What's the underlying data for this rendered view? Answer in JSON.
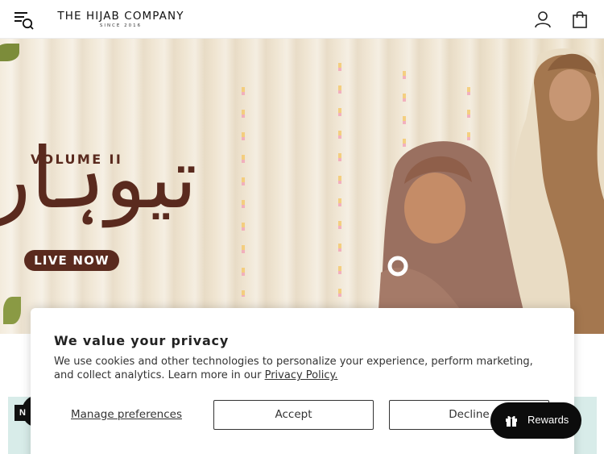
{
  "header": {
    "brand_name": "THE HIJAB COMPANY",
    "brand_tagline": "SINCE 2016",
    "icons": [
      "menu-search-icon",
      "account-icon",
      "shopping-bag-icon"
    ]
  },
  "hero": {
    "volume_label": "VOLUME II",
    "title_urdu": "تیوہار",
    "cta_label": "LIVE NOW"
  },
  "below": {
    "badge_letter": "N"
  },
  "privacy": {
    "title": "We value your privacy",
    "body": "We use cookies and other technologies to personalize your experience, perform marketing, and collect analytics. Learn more in our ",
    "link_label": "Privacy Policy.",
    "manage_label": "Manage preferences",
    "accept_label": "Accept",
    "decline_label": "Decline"
  },
  "rewards": {
    "label": "Rewards",
    "icon": "gift-icon"
  },
  "colors": {
    "brand_brown": "#5a2a1e",
    "rewards_bg": "#0c0c0c",
    "hero_bg": "#f0e6d4"
  }
}
